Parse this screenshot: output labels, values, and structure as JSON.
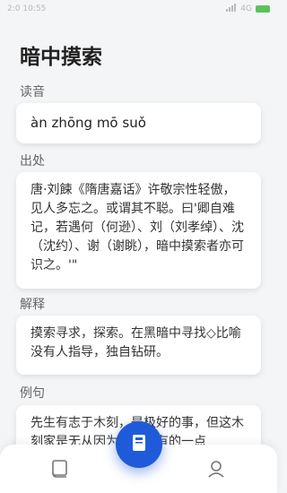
{
  "status_bar": {
    "time": "2:0 10:55",
    "network": "4G"
  },
  "title": "暗中摸索",
  "sections": {
    "pronunciation": {
      "label": "读音",
      "value": "àn zhōng mō suǒ"
    },
    "source": {
      "label": "出处",
      "value": "唐·刘餗《隋唐嘉话》许敬宗性轻傲，见人多忘之。或谓其不聪。曰'卿自难记，若遇何（何逊）、刘（刘孝绰）、沈（沈约）、谢（谢眺），暗中摸索者亦可识之。'\""
    },
    "meaning": {
      "label": "解释",
      "value": "摸索寻求，探索。在黑暗中寻找◇比喻没有人指导，独自钻研。"
    },
    "example": {
      "label": "例句",
      "value": "先生有志于木刻，是极好的事，但这木刻家是无从因为就是已有的一点"
    }
  },
  "colors": {
    "accent": "#1f5bd9",
    "background": "#f4f5f7",
    "card": "#ffffff"
  },
  "nav": {
    "left_icon": "book-icon",
    "center_icon": "bookmark-book-icon",
    "right_icon": "profile-icon"
  }
}
